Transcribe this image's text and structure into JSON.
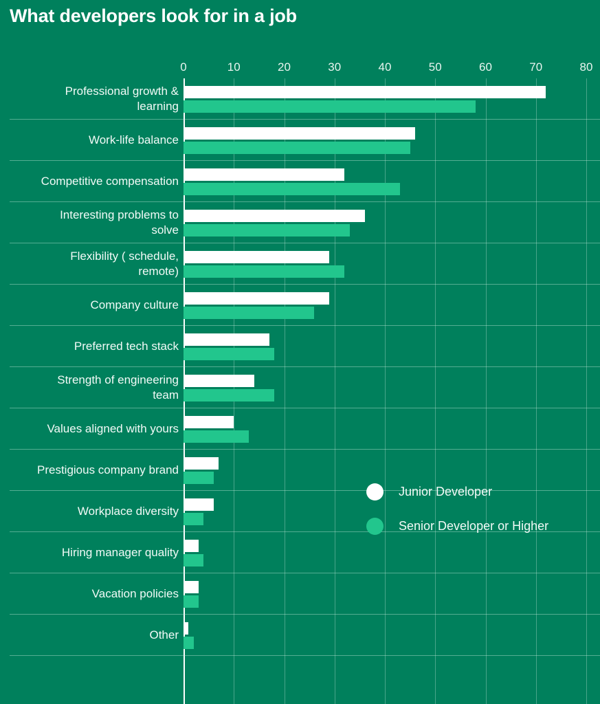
{
  "chart_data": {
    "type": "bar",
    "orientation": "horizontal",
    "title": "What developers look for in a job",
    "xlabel": "",
    "ylabel": "",
    "xlim": [
      0,
      80
    ],
    "xticks": [
      0,
      10,
      20,
      30,
      40,
      50,
      60,
      70,
      80
    ],
    "grid": true,
    "legend_position": "center-right",
    "categories": [
      "Professional growth &\nlearning",
      "Work-life balance",
      "Competitive compensation",
      "Interesting problems to\nsolve",
      "Flexibility ( schedule,\nremote)",
      "Company culture",
      "Preferred tech stack",
      "Strength of engineering\nteam",
      "Values aligned with yours",
      "Prestigious company brand",
      "Workplace diversity",
      "Hiring manager quality",
      "Vacation policies",
      "Other"
    ],
    "series": [
      {
        "name": "Junior Developer",
        "color": "#ffffff",
        "values": [
          72,
          46,
          32,
          36,
          29,
          29,
          17,
          14,
          10,
          7,
          6,
          3,
          3,
          1
        ]
      },
      {
        "name": "Senior Developer or Higher",
        "color": "#22c68d",
        "values": [
          58,
          45,
          43,
          33,
          32,
          26,
          18,
          18,
          13,
          6,
          4,
          4,
          3,
          2
        ]
      }
    ]
  },
  "theme": {
    "background": "#00805c",
    "text": "#f2faf7",
    "grid": "rgba(215,238,229,0.34)",
    "accent_white": "#ffffff",
    "accent_green": "#22c68d"
  }
}
